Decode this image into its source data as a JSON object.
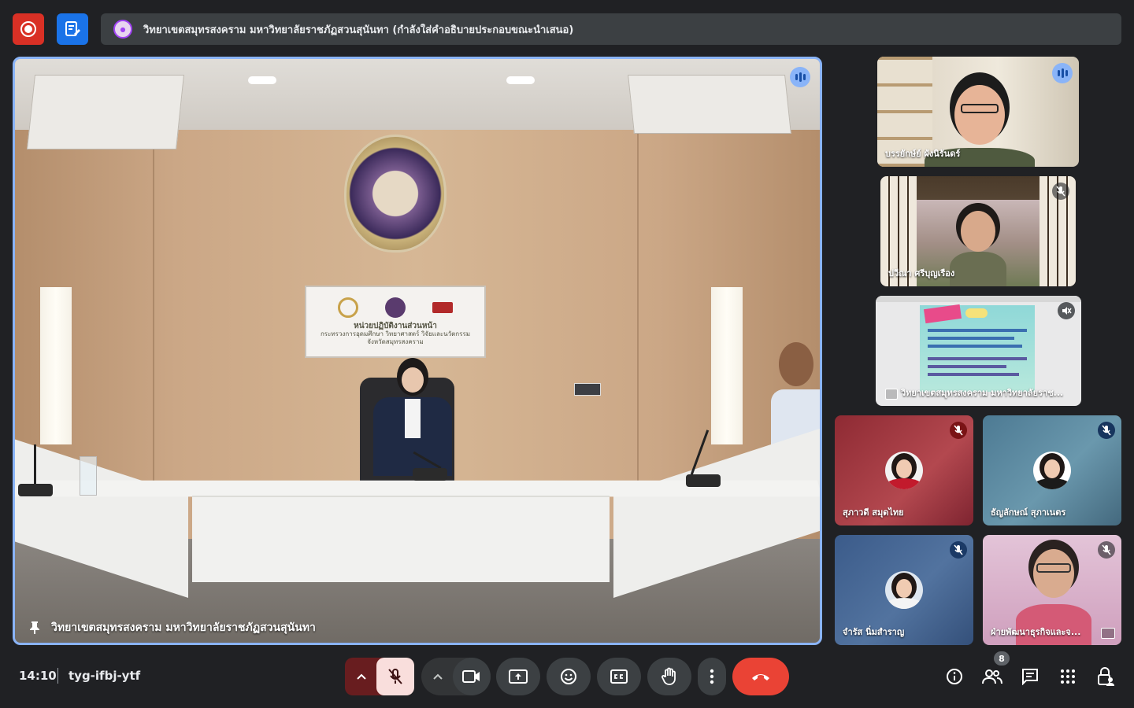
{
  "banner": {
    "text": "วิทยาเขตสมุทรสงคราม มหาวิทยาลัยราชภัฏสวนสุนันทา (กำลังใส่คำอธิบายประกอบขณะนำเสนอ)"
  },
  "main_tile": {
    "name": "วิทยาเขตสมุทรสงคราม มหาวิทยาลัยราชภัฏสวนสุนันทา",
    "sign_line1": "หน่วยปฏิบัติงานส่วนหน้า",
    "sign_line2": "กระทรวงการอุดมศึกษา วิทยาศาสตร์ วิจัยและนวัตกรรม",
    "sign_line3": "จังหวัดสมุทรสงคราม"
  },
  "participants": [
    {
      "name": "บรรยักษ์ย์ ผังนิรันดร์",
      "state": "speaking"
    },
    {
      "name": "ปวีณา ศรีบุญเรือง",
      "state": "muted"
    },
    {
      "name": "วิทยาเขตสมุทรสงคราม มหาวิทยาลัยราช...",
      "state": "presentation-muted"
    },
    {
      "name": "สุภาวดี สมุดไทย",
      "state": "muted"
    },
    {
      "name": "ธัญลักษณ์ สุภาเนตร",
      "state": "muted"
    },
    {
      "name": "จำรัส นิ่มสำราญ",
      "state": "muted"
    },
    {
      "name": "ฝ่ายพัฒนาธุรกิจและจ...",
      "state": "muted"
    }
  ],
  "bottom_bar": {
    "time": "14:10",
    "meeting_code": "tyg-ifbj-ytf",
    "people_count": "8"
  },
  "colors": {
    "background": "#202124",
    "active_border": "#8ab4f8",
    "end_call": "#ea4335",
    "mic_off": "#f9dedc"
  }
}
